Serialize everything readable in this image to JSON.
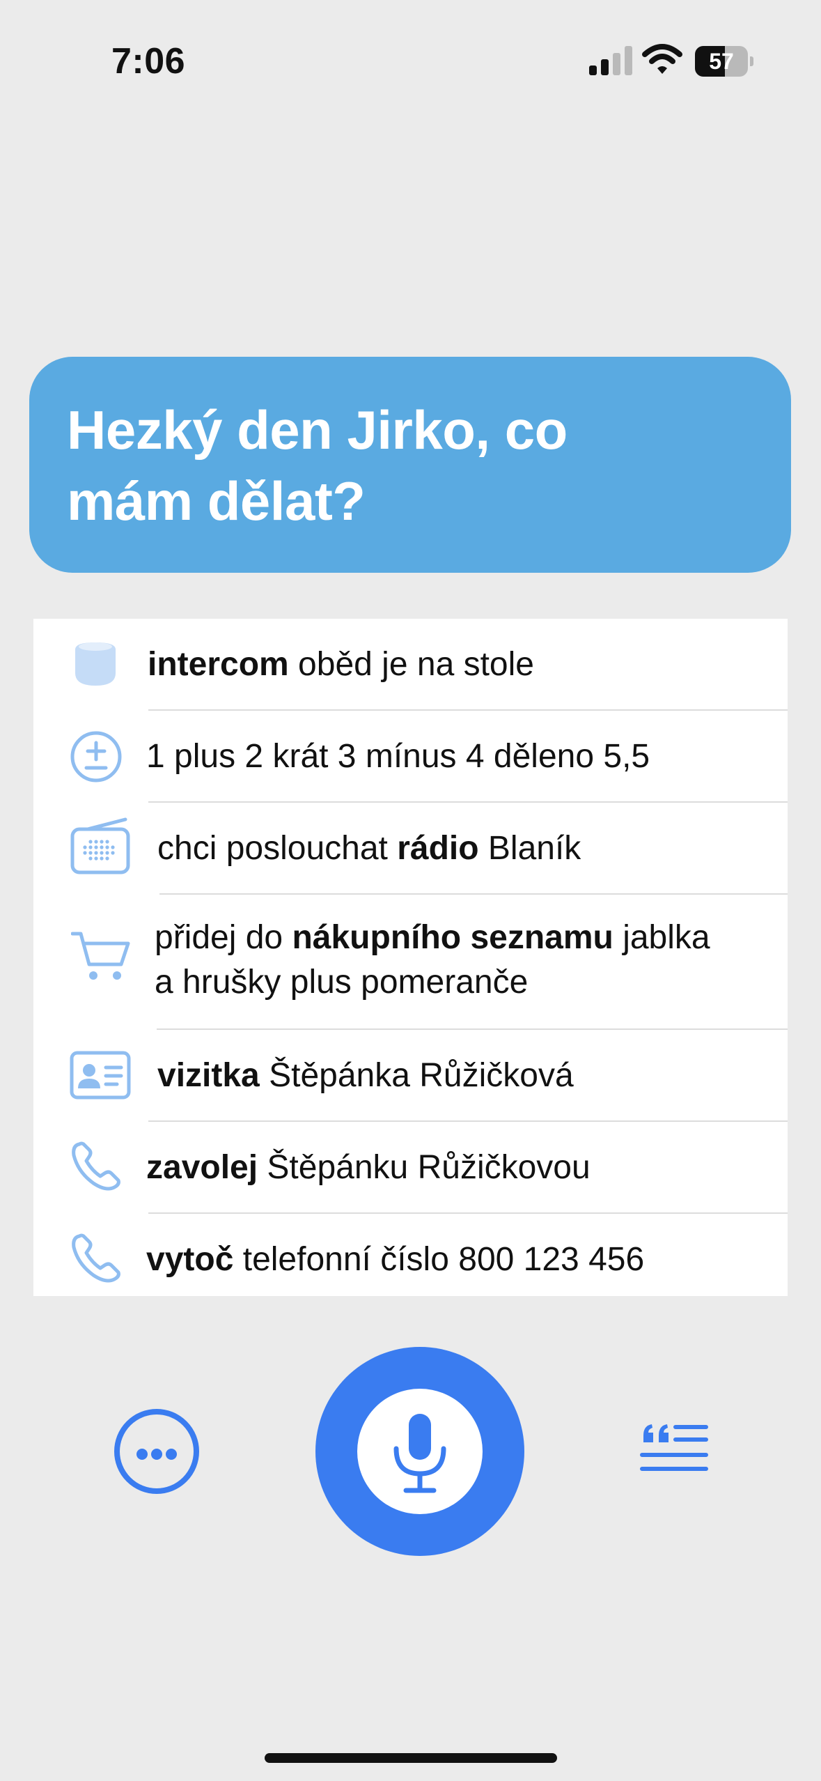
{
  "status_bar": {
    "time": "7:06",
    "battery_level": "57",
    "battery_fraction": 0.57,
    "signal_icon": "cellular-signal-icon",
    "wifi_icon": "wifi-icon"
  },
  "greeting": {
    "line1": "Hezký den Jirko, co",
    "line2": "mám dělat?"
  },
  "suggestions": [
    {
      "icon": "homepod-icon",
      "bold": "intercom",
      "rest": " oběd je na stole"
    },
    {
      "icon": "plus-minus-icon",
      "plain": "1 plus 2 krát 3 mínus 4 děleno 5,5"
    },
    {
      "icon": "radio-icon",
      "pre": "chci poslouchat ",
      "bold": "rádio",
      "rest": " Blaník"
    },
    {
      "icon": "cart-icon",
      "pre": "přidej do ",
      "bold": "nákupního seznamu",
      "rest": " jablka",
      "line2": "a hrušky plus pomeranče"
    },
    {
      "icon": "contact-card-icon",
      "bold": "vizitka",
      "rest": " Štěpánka Růžičková"
    },
    {
      "icon": "phone-icon",
      "bold": "zavolej",
      "rest": " Štěpánku Růžičkovou"
    },
    {
      "icon": "phone-icon",
      "bold": "vytoč",
      "rest": " telefonní číslo 800 123 456"
    }
  ],
  "controls": {
    "more_icon": "ellipsis-icon",
    "mic_icon": "microphone-icon",
    "transcript_icon": "quote-text-icon"
  },
  "colors": {
    "accent": "#3a7cf0",
    "bubble": "#5aaae1",
    "icon_light": "#8fbdf0",
    "background": "#ebebeb"
  }
}
